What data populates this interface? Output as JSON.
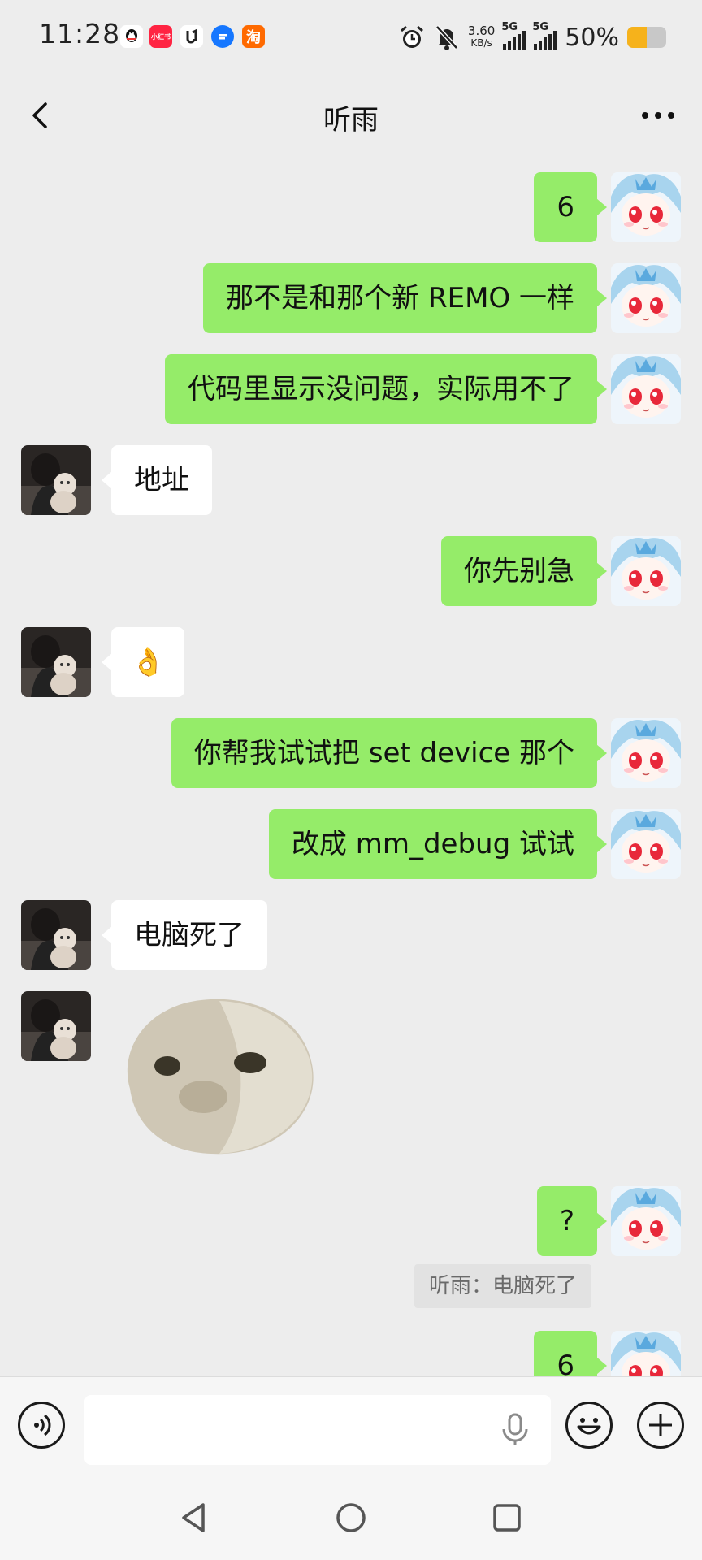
{
  "status_bar": {
    "time": "11:28",
    "net_speed_value": "3.60",
    "net_speed_unit": "KB/s",
    "signal1_label": "5G",
    "signal2_label": "5G",
    "battery_percent": "50%",
    "battery_level": 0.5,
    "apps": [
      {
        "name": "qq-icon",
        "text": "",
        "color": "#111111"
      },
      {
        "name": "xiaohongshu-icon",
        "text": "小红书",
        "color": "#ff2442"
      },
      {
        "name": "app-icon",
        "text": "",
        "color": "#222222"
      },
      {
        "name": "app-blue-icon",
        "text": "",
        "color": "#1677ff"
      },
      {
        "name": "taobao-icon",
        "text": "淘",
        "color": "#ff6a00"
      }
    ]
  },
  "header": {
    "title": "听雨"
  },
  "messages": [
    {
      "side": "mine",
      "text": "6"
    },
    {
      "side": "mine",
      "text": "那不是和那个新 REMO 一样"
    },
    {
      "side": "mine",
      "text": "代码里显示没问题，实际用不了"
    },
    {
      "side": "other",
      "text": "地址"
    },
    {
      "side": "mine",
      "text": "你先别急"
    },
    {
      "side": "other",
      "text": "👌"
    },
    {
      "side": "mine",
      "text": "你帮我试试把 set device 那个"
    },
    {
      "side": "mine",
      "text": "改成 mm_debug 试试"
    },
    {
      "side": "other",
      "text": "电脑死了"
    },
    {
      "side": "other",
      "sticker": true
    },
    {
      "side": "mine",
      "text": "?"
    },
    {
      "quote": "听雨：电脑死了"
    },
    {
      "side": "mine",
      "text": "6"
    }
  ],
  "colors": {
    "my_bubble": "#95ec69",
    "other_bubble": "#ffffff",
    "background": "#ededed"
  }
}
